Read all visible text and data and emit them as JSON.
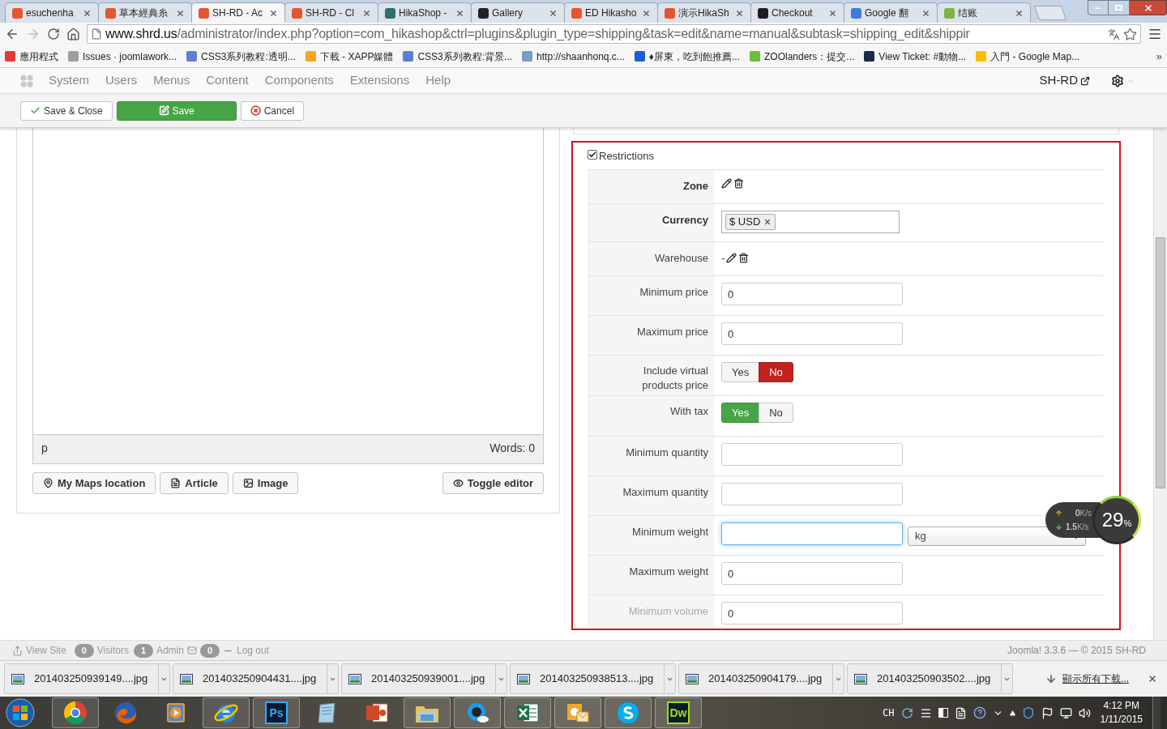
{
  "browser": {
    "tabs": [
      {
        "title": "esuchenha",
        "selected": false,
        "color": "#e4572e"
      },
      {
        "title": "草本經典糸",
        "selected": false,
        "color": "#e4572e"
      },
      {
        "title": "SH-RD - Ac",
        "selected": true,
        "color": "#e4572e"
      },
      {
        "title": "SH-RD - Cl",
        "selected": false,
        "color": "#e4572e"
      },
      {
        "title": "HikaShop -",
        "selected": false,
        "color": "#2d6f6a"
      },
      {
        "title": "Gallery",
        "selected": false,
        "color": "#222222"
      },
      {
        "title": "ED Hikasho",
        "selected": false,
        "color": "#e4572e"
      },
      {
        "title": "演示HikaSh",
        "selected": false,
        "color": "#e4572e"
      },
      {
        "title": "Checkout",
        "selected": false,
        "color": "#1d1d1d"
      },
      {
        "title": "Google 翻",
        "selected": false,
        "color": "#3b7dd8"
      },
      {
        "title": "结账",
        "selected": false,
        "color": "#7cb342"
      }
    ],
    "address_host": "www.shrd.us",
    "address_path": "/administrator/index.php?option=com_hikashop&ctrl=plugins&plugin_type=shipping&task=edit&name=manual&subtask=shipping_edit&shippir",
    "bookmarks": [
      {
        "title": "應用程式",
        "color": "#e53935"
      },
      {
        "title": "Issues · joomlawork...",
        "color": "#9e9e9e"
      },
      {
        "title": "CSS3系列教程:透明...",
        "color": "#5c7fd6"
      },
      {
        "title": "下載 - XAPP媒體",
        "color": "#f4a623"
      },
      {
        "title": "CSS3系列教程:背景...",
        "color": "#5c7fd6"
      },
      {
        "title": "http://shaanhonq.c...",
        "color": "#7a9cc6"
      },
      {
        "title": "♦屏東，吃到飽推薦...",
        "color": "#1e5bd6"
      },
      {
        "title": "ZOOlanders：提交...",
        "color": "#6abf3b"
      },
      {
        "title": "View Ticket: #動物...",
        "color": "#1b2a4a"
      },
      {
        "title": "入門 - Google Map...",
        "color": "#fbbc05"
      }
    ],
    "more": "»"
  },
  "admin_menu": {
    "items": [
      "System",
      "Users",
      "Menus",
      "Content",
      "Components",
      "Extensions",
      "Help"
    ],
    "site": "SH-RD"
  },
  "toolbar": {
    "buttons": [
      {
        "label": "Save & Close",
        "kind": "save_close"
      },
      {
        "label": "Save",
        "kind": "save"
      },
      {
        "label": "Cancel",
        "kind": "cancel"
      }
    ]
  },
  "editor": {
    "path": "p",
    "word_count": "Words: 0",
    "buttons": [
      {
        "label": "My Maps location",
        "kind": "map"
      },
      {
        "label": "Article",
        "kind": "article"
      },
      {
        "label": "Image",
        "kind": "image"
      },
      {
        "label": "Toggle editor",
        "kind": "toggle"
      }
    ]
  },
  "restrictions": {
    "legend": "Restrictions",
    "checked": true,
    "rows": [
      {
        "label": "Zone",
        "kind": "icons",
        "bold": true
      },
      {
        "label": "Currency",
        "kind": "tag",
        "bold": true,
        "tag": "$ USD"
      },
      {
        "label": "Warehouse",
        "kind": "icons",
        "bold": false,
        "prefix": "-"
      },
      {
        "label": "Minimum price",
        "kind": "input",
        "bold": false,
        "value": "0",
        "focused": false
      },
      {
        "label": "Maximum price",
        "kind": "input",
        "bold": false,
        "value": "0",
        "focused": false
      },
      {
        "label": "Include virtual products price",
        "kind": "toggle",
        "bold": false,
        "options": [
          {
            "label": "Yes",
            "kind": "yes",
            "selected": false
          },
          {
            "label": "No",
            "kind": "no",
            "selected": true
          }
        ]
      },
      {
        "label": "With tax",
        "kind": "toggle",
        "bold": false,
        "options": [
          {
            "label": "Yes",
            "kind": "yes",
            "selected": true
          },
          {
            "label": "No",
            "kind": "no",
            "selected": false
          }
        ]
      },
      {
        "label": "Minimum quantity",
        "kind": "input",
        "bold": false,
        "focused": false
      },
      {
        "label": "Maximum quantity",
        "kind": "input",
        "bold": false,
        "focused": false
      },
      {
        "label": "Minimum weight",
        "kind": "input",
        "bold": false,
        "focused": true,
        "unit": "kg"
      },
      {
        "label": "Maximum weight",
        "kind": "input",
        "bold": false,
        "value": "0",
        "focused": false
      },
      {
        "label": "Minimum volume",
        "kind": "input",
        "bold": false,
        "value": "0",
        "focused": false
      }
    ]
  },
  "network_widget": {
    "upload": "0",
    "upload_unit": "K/s",
    "download": "1.5",
    "download_unit": "K/s",
    "percent": "29",
    "percent_sign": "%"
  },
  "status_bar": {
    "view_site": "View Site",
    "visitors_count": "0",
    "visitors": "Visitors",
    "admin_count": "1",
    "admin": "Admin",
    "messages_count": "0",
    "logout": "Log out",
    "footer": "Joomla! 3.3.6 — © 2015 SH-RD"
  },
  "downloads": {
    "files": [
      "201403250939149....jpg",
      "201403250904431....jpg",
      "201403250939001....jpg",
      "201403250938513....jpg",
      "201403250904179....jpg",
      "201403250903502....jpg"
    ],
    "show_all": "顯示所有下載..."
  },
  "taskbar": {
    "apps": [
      {
        "kind": "chrome",
        "running": true
      },
      {
        "kind": "firefox",
        "running": false
      },
      {
        "kind": "media",
        "running": false
      },
      {
        "kind": "ie",
        "running": true
      },
      {
        "kind": "text",
        "label": "Ps",
        "color": "#31a8ff",
        "running": true
      },
      {
        "kind": "notepad",
        "running": false
      },
      {
        "kind": "powerpoint",
        "running": false
      },
      {
        "kind": "folder",
        "running": true
      },
      {
        "kind": "cloud",
        "running": true
      },
      {
        "kind": "excel",
        "running": true
      },
      {
        "kind": "outlook",
        "running": true
      },
      {
        "kind": "skype",
        "running": true
      },
      {
        "kind": "text",
        "label": "Dw",
        "color": "#9be01b",
        "running": true
      }
    ],
    "language": "CH",
    "time": "4:12 PM",
    "date": "1/11/2015"
  }
}
